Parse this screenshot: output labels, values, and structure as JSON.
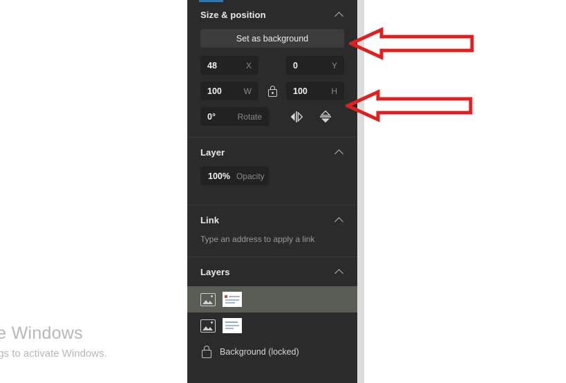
{
  "panel": {
    "sections": {
      "size_position": {
        "title": "Size & position",
        "set_background_label": "Set as background",
        "fields": [
          {
            "value": "48",
            "unit": "X"
          },
          {
            "value": "0",
            "unit": "Y"
          },
          {
            "value": "100",
            "unit": "W"
          },
          {
            "value": "100",
            "unit": "H"
          },
          {
            "value": "0°",
            "unit": "Rotate"
          }
        ],
        "lock_icon": "lock-closed-icon",
        "flip_horizontal_icon": "flip-horizontal-icon",
        "flip_vertical_icon": "flip-vertical-icon"
      },
      "layer": {
        "title": "Layer",
        "opacity_value": "100%",
        "opacity_label": "Opacity"
      },
      "link": {
        "title": "Link",
        "hint": "Type an address to apply a link"
      },
      "layers": {
        "title": "Layers",
        "items": [
          {
            "name": "",
            "icon": "image-icon",
            "selected": true,
            "locked": false
          },
          {
            "name": "",
            "icon": "image-icon",
            "selected": false,
            "locked": false
          },
          {
            "name": "Background (locked)",
            "icon": "lock-closed-icon",
            "selected": false,
            "locked": true
          }
        ]
      }
    },
    "collapse_icon": "chevron-up-icon"
  },
  "watermark": {
    "title": "Activate Windows",
    "subtitle": "Go to Settings to activate Windows."
  },
  "annotations": {
    "color": "#e02020",
    "arrows": [
      {
        "name": "arrow-to-set-as-background",
        "points_to": "Set as background"
      },
      {
        "name": "arrow-to-height-field",
        "points_to": "H"
      }
    ]
  },
  "colors": {
    "panel_bg": "#2b2b2b",
    "field_bg": "#222222",
    "button_bg": "#3c3c3c",
    "accent_tab": "#2a79c4",
    "selected_row": "#585e55",
    "annotation_red": "#e02020",
    "scrollbar": "#dcdcdc"
  }
}
